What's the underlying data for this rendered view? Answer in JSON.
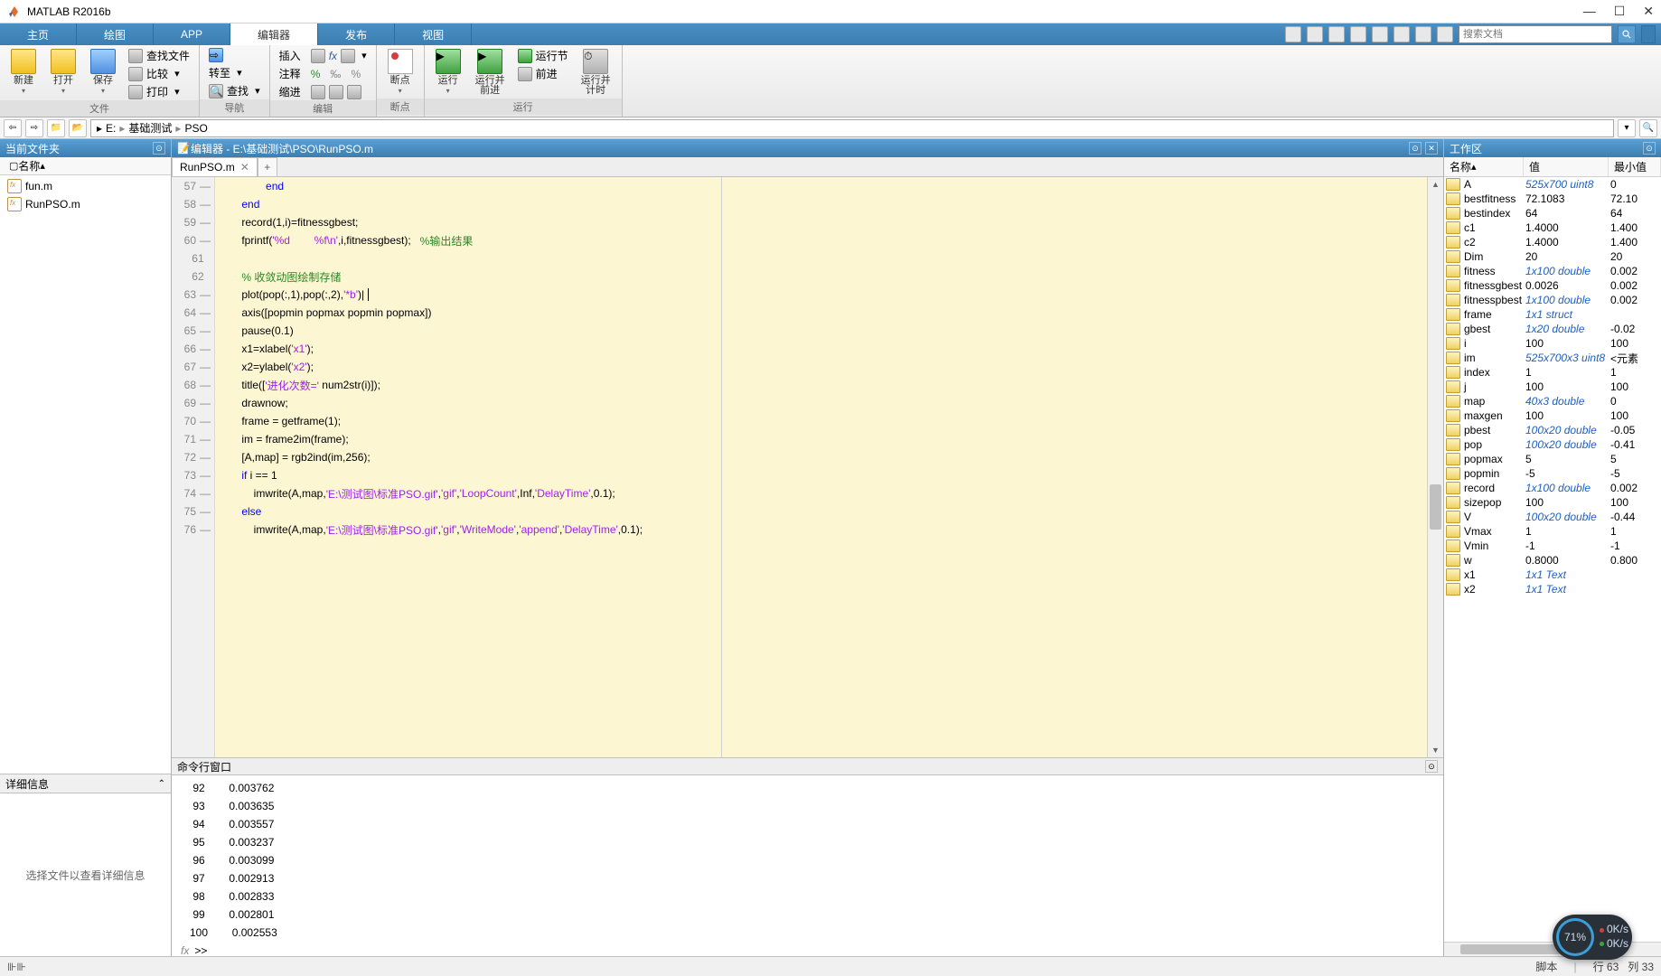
{
  "title": "MATLAB R2016b",
  "tabs": {
    "items": [
      "主页",
      "绘图",
      "APP",
      "编辑器",
      "发布",
      "视图"
    ],
    "active": 3
  },
  "search_placeholder": "搜索文档",
  "toolstrip": {
    "file": {
      "label": "文件",
      "new": "新建",
      "open": "打开",
      "save": "保存",
      "findfiles": "查找文件",
      "compare": "比较",
      "print": "打印"
    },
    "nav": {
      "label": "导航",
      "goto": "转至",
      "find": "查找"
    },
    "edit": {
      "label": "编辑",
      "insert": "插入",
      "comment": "注释",
      "indent": "缩进",
      "fx": "fx"
    },
    "bp": {
      "label": "断点",
      "btn": "断点"
    },
    "run": {
      "label": "运行",
      "run": "运行",
      "runadv": "运行并\n前进",
      "runsec": "运行节",
      "advance": "前进",
      "runtime": "运行并\n计时"
    }
  },
  "path": {
    "drive": "E:",
    "parts": [
      "基础测试",
      "PSO"
    ]
  },
  "current_folder": {
    "title": "当前文件夹",
    "name_col": "名称",
    "files": [
      "fun.m",
      "RunPSO.m"
    ]
  },
  "details": {
    "title": "详细信息",
    "msg": "选择文件以查看详细信息"
  },
  "editor": {
    "title": "编辑器 - E:\\基础测试\\PSO\\RunPSO.m",
    "tab": "RunPSO.m",
    "first_line": 57,
    "lines": [
      {
        "n": 57,
        "dash": true,
        "seg": [
          {
            "t": "            "
          },
          {
            "t": "end",
            "c": "kw"
          }
        ]
      },
      {
        "n": 58,
        "dash": true,
        "seg": [
          {
            "t": "    "
          },
          {
            "t": "end",
            "c": "kw"
          }
        ]
      },
      {
        "n": 59,
        "dash": true,
        "seg": [
          {
            "t": "    record(1,i)=fitnessgbest;"
          }
        ]
      },
      {
        "n": 60,
        "dash": true,
        "seg": [
          {
            "t": "    fprintf("
          },
          {
            "t": "'%d        %f\\n'",
            "c": "str"
          },
          {
            "t": ",i,fitnessgbest);   "
          },
          {
            "t": "%输出结果",
            "c": "cmt"
          }
        ]
      },
      {
        "n": 61,
        "dash": false,
        "seg": [
          {
            "t": ""
          }
        ]
      },
      {
        "n": 62,
        "dash": false,
        "seg": [
          {
            "t": "    "
          },
          {
            "t": "% 收敛动图绘制存储",
            "c": "cmt"
          }
        ]
      },
      {
        "n": 63,
        "dash": true,
        "cursor": true,
        "seg": [
          {
            "t": "    plot(pop(:,1),pop(:,2),"
          },
          {
            "t": "'*b'",
            "c": "str"
          },
          {
            "t": ")|"
          }
        ]
      },
      {
        "n": 64,
        "dash": true,
        "seg": [
          {
            "t": "    axis([popmin popmax popmin popmax])"
          }
        ]
      },
      {
        "n": 65,
        "dash": true,
        "seg": [
          {
            "t": "    pause(0.1)"
          }
        ]
      },
      {
        "n": 66,
        "dash": true,
        "seg": [
          {
            "t": "    x1=xlabel("
          },
          {
            "t": "'x1'",
            "c": "str"
          },
          {
            "t": ");"
          }
        ]
      },
      {
        "n": 67,
        "dash": true,
        "seg": [
          {
            "t": "    x2=ylabel("
          },
          {
            "t": "'x2'",
            "c": "str"
          },
          {
            "t": ");"
          }
        ]
      },
      {
        "n": 68,
        "dash": true,
        "seg": [
          {
            "t": "    title(["
          },
          {
            "t": "'进化次数='",
            "c": "str"
          },
          {
            "t": " num2str(i)]);"
          }
        ]
      },
      {
        "n": 69,
        "dash": true,
        "seg": [
          {
            "t": "    drawnow;"
          }
        ]
      },
      {
        "n": 70,
        "dash": true,
        "seg": [
          {
            "t": "    frame = getframe(1);"
          }
        ]
      },
      {
        "n": 71,
        "dash": true,
        "seg": [
          {
            "t": "    im = frame2im(frame);"
          }
        ]
      },
      {
        "n": 72,
        "dash": true,
        "seg": [
          {
            "t": "    [A,map] = rgb2ind(im,256);"
          }
        ]
      },
      {
        "n": 73,
        "dash": true,
        "seg": [
          {
            "t": "    "
          },
          {
            "t": "if",
            "c": "kw"
          },
          {
            "t": " i == 1"
          }
        ]
      },
      {
        "n": 74,
        "dash": true,
        "seg": [
          {
            "t": "        imwrite(A,map,"
          },
          {
            "t": "'E:\\测试图\\标准PSO.gif'",
            "c": "str"
          },
          {
            "t": ","
          },
          {
            "t": "'gif'",
            "c": "str"
          },
          {
            "t": ","
          },
          {
            "t": "'LoopCount'",
            "c": "str"
          },
          {
            "t": ",Inf,"
          },
          {
            "t": "'DelayTime'",
            "c": "str"
          },
          {
            "t": ",0.1);"
          }
        ]
      },
      {
        "n": 75,
        "dash": true,
        "seg": [
          {
            "t": "    "
          },
          {
            "t": "else",
            "c": "kw"
          }
        ]
      },
      {
        "n": 76,
        "dash": true,
        "seg": [
          {
            "t": "        imwrite(A,map,"
          },
          {
            "t": "'E:\\测试图\\标准PSO.gif'",
            "c": "str"
          },
          {
            "t": ","
          },
          {
            "t": "'gif'",
            "c": "str"
          },
          {
            "t": ","
          },
          {
            "t": "'WriteMode'",
            "c": "str"
          },
          {
            "t": ","
          },
          {
            "t": "'append'",
            "c": "str"
          },
          {
            "t": ","
          },
          {
            "t": "'DelayTime'",
            "c": "str"
          },
          {
            "t": ",0.1);"
          }
        ]
      }
    ]
  },
  "command": {
    "title": "命令行窗口",
    "lines": [
      {
        "i": "92",
        "v": "0.003762"
      },
      {
        "i": "93",
        "v": "0.003635"
      },
      {
        "i": "94",
        "v": "0.003557"
      },
      {
        "i": "95",
        "v": "0.003237"
      },
      {
        "i": "96",
        "v": "0.003099"
      },
      {
        "i": "97",
        "v": "0.002913"
      },
      {
        "i": "98",
        "v": "0.002833"
      },
      {
        "i": "99",
        "v": "0.002801"
      },
      {
        "i": "100",
        "v": "0.002553"
      }
    ],
    "prompt_fx": "fx",
    "prompt": ">>"
  },
  "workspace": {
    "title": "工作区",
    "cols": [
      "名称",
      "值",
      "最小值"
    ],
    "vars": [
      {
        "n": "A",
        "v": "525x700 uint8",
        "l": true,
        "m": "0"
      },
      {
        "n": "bestfitness",
        "v": "72.1083",
        "m": "72.10"
      },
      {
        "n": "bestindex",
        "v": "64",
        "m": "64"
      },
      {
        "n": "c1",
        "v": "1.4000",
        "m": "1.400"
      },
      {
        "n": "c2",
        "v": "1.4000",
        "m": "1.400"
      },
      {
        "n": "Dim",
        "v": "20",
        "m": "20"
      },
      {
        "n": "fitness",
        "v": "1x100 double",
        "l": true,
        "m": "0.002"
      },
      {
        "n": "fitnessgbest",
        "v": "0.0026",
        "m": "0.002"
      },
      {
        "n": "fitnesspbest",
        "v": "1x100 double",
        "l": true,
        "m": "0.002"
      },
      {
        "n": "frame",
        "v": "1x1 struct",
        "l": true,
        "m": ""
      },
      {
        "n": "gbest",
        "v": "1x20 double",
        "l": true,
        "m": "-0.02"
      },
      {
        "n": "i",
        "v": "100",
        "m": "100"
      },
      {
        "n": "im",
        "v": "525x700x3 uint8",
        "l": true,
        "m": "<元素"
      },
      {
        "n": "index",
        "v": "1",
        "m": "1"
      },
      {
        "n": "j",
        "v": "100",
        "m": "100"
      },
      {
        "n": "map",
        "v": "40x3 double",
        "l": true,
        "m": "0"
      },
      {
        "n": "maxgen",
        "v": "100",
        "m": "100"
      },
      {
        "n": "pbest",
        "v": "100x20 double",
        "l": true,
        "m": "-0.05"
      },
      {
        "n": "pop",
        "v": "100x20 double",
        "l": true,
        "m": "-0.41"
      },
      {
        "n": "popmax",
        "v": "5",
        "m": "5"
      },
      {
        "n": "popmin",
        "v": "-5",
        "m": "-5"
      },
      {
        "n": "record",
        "v": "1x100 double",
        "l": true,
        "m": "0.002"
      },
      {
        "n": "sizepop",
        "v": "100",
        "m": "100"
      },
      {
        "n": "V",
        "v": "100x20 double",
        "l": true,
        "m": "-0.44"
      },
      {
        "n": "Vmax",
        "v": "1",
        "m": "1"
      },
      {
        "n": "Vmin",
        "v": "-1",
        "m": "-1"
      },
      {
        "n": "w",
        "v": "0.8000",
        "m": "0.800"
      },
      {
        "n": "x1",
        "v": "1x1 Text",
        "l": true,
        "m": ""
      },
      {
        "n": "x2",
        "v": "1x1 Text",
        "l": true,
        "m": ""
      }
    ]
  },
  "status": {
    "script": "脚本",
    "line_lbl": "行",
    "line": "63",
    "col_lbl": "列",
    "col": "33"
  },
  "perf": {
    "pct": "71%",
    "up": "0K/s",
    "down": "0K/s"
  }
}
